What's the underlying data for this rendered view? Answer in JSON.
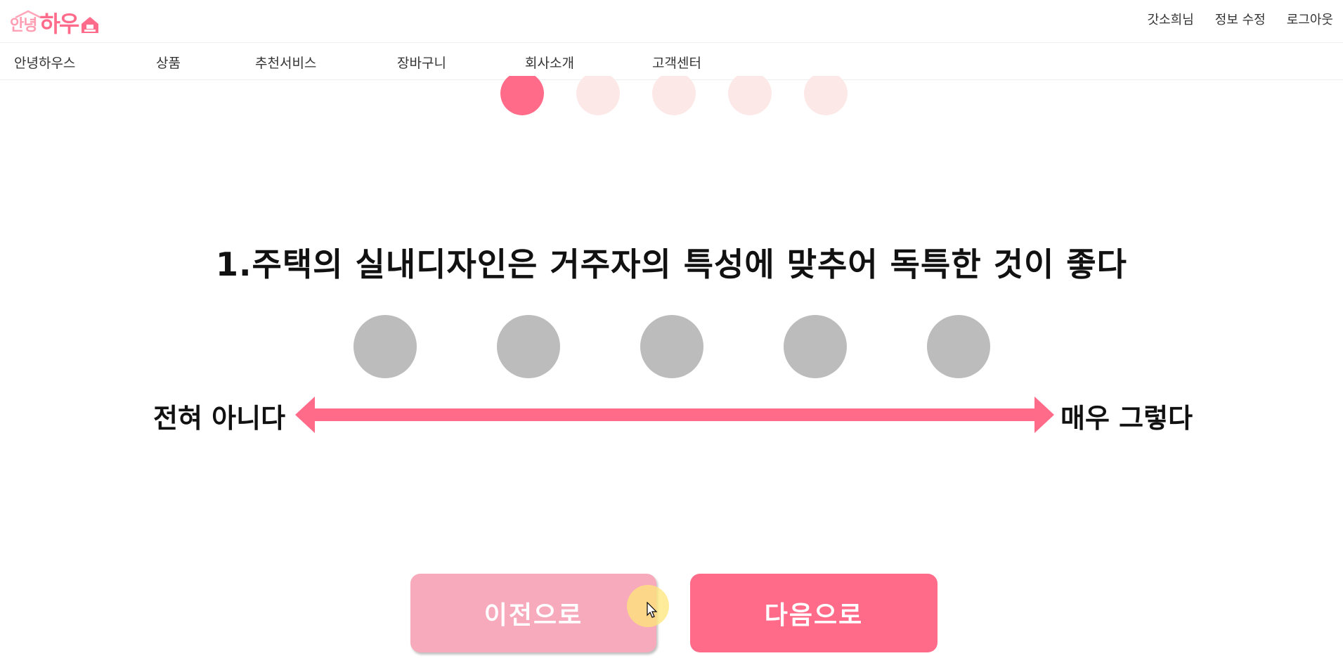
{
  "logo": {
    "small": "안녕",
    "big": "하우"
  },
  "header": {
    "user_links": [
      "갓소희님",
      "정보 수정",
      "로그아웃"
    ]
  },
  "nav": {
    "items": [
      "안녕하우스",
      "상품",
      "추천서비스",
      "장바구니",
      "회사소개",
      "고객센터"
    ]
  },
  "progress": {
    "steps": 5,
    "current": 1,
    "active_color": "#ff6b88",
    "inactive_color": "#fde8e8"
  },
  "question": {
    "text": "1.주택의 실내디자인은 거주자의 특성에 맞추어 독특한 것이 좋다"
  },
  "answers": {
    "count": 5,
    "color": "#bcbcbc"
  },
  "scale": {
    "left_label": "전혀 아니다",
    "right_label": "매우 그렇다",
    "arrow_color": "#ff6b88"
  },
  "buttons": {
    "prev_label": "이전으로",
    "next_label": "다음으로"
  }
}
